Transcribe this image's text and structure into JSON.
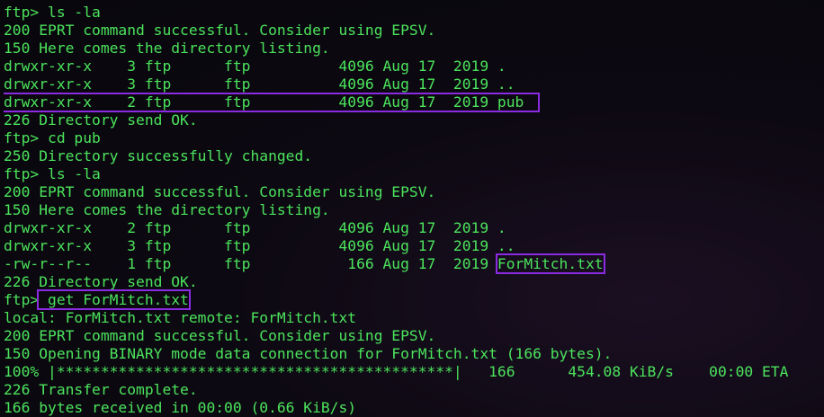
{
  "colors": {
    "text": "#4be35c",
    "highlight_box": "#8a2be2",
    "background": "#0d0912"
  },
  "terminal": {
    "lines": [
      "ftp> ls -la",
      "200 EPRT command successful. Consider using EPSV.",
      "150 Here comes the directory listing.",
      "drwxr-xr-x    3 ftp      ftp          4096 Aug 17  2019 .",
      "drwxr-xr-x    3 ftp      ftp          4096 Aug 17  2019 ..",
      "drwxr-xr-x    2 ftp      ftp          4096 Aug 17  2019 pub",
      "226 Directory send OK.",
      "ftp> cd pub",
      "250 Directory successfully changed.",
      "ftp> ls -la",
      "200 EPRT command successful. Consider using EPSV.",
      "150 Here comes the directory listing.",
      "drwxr-xr-x    2 ftp      ftp          4096 Aug 17  2019 .",
      "drwxr-xr-x    3 ftp      ftp          4096 Aug 17  2019 ..",
      "-rw-r--r--    1 ftp      ftp           166 Aug 17  2019 ",
      "226 Directory send OK.",
      "ftp>",
      "local: ForMitch.txt remote: ForMitch.txt",
      "200 EPRT command successful. Consider using EPSV.",
      "150 Opening BINARY mode data connection for ForMitch.txt (166 bytes).",
      "100% |*********************************************|   166      454.08 KiB/s    00:00 ETA",
      "226 Transfer complete.",
      "166 bytes received in 00:00 (0.66 KiB/s)"
    ],
    "highlight_filename": "ForMitch.txt",
    "highlight_command": " get ForMitch.txt"
  }
}
